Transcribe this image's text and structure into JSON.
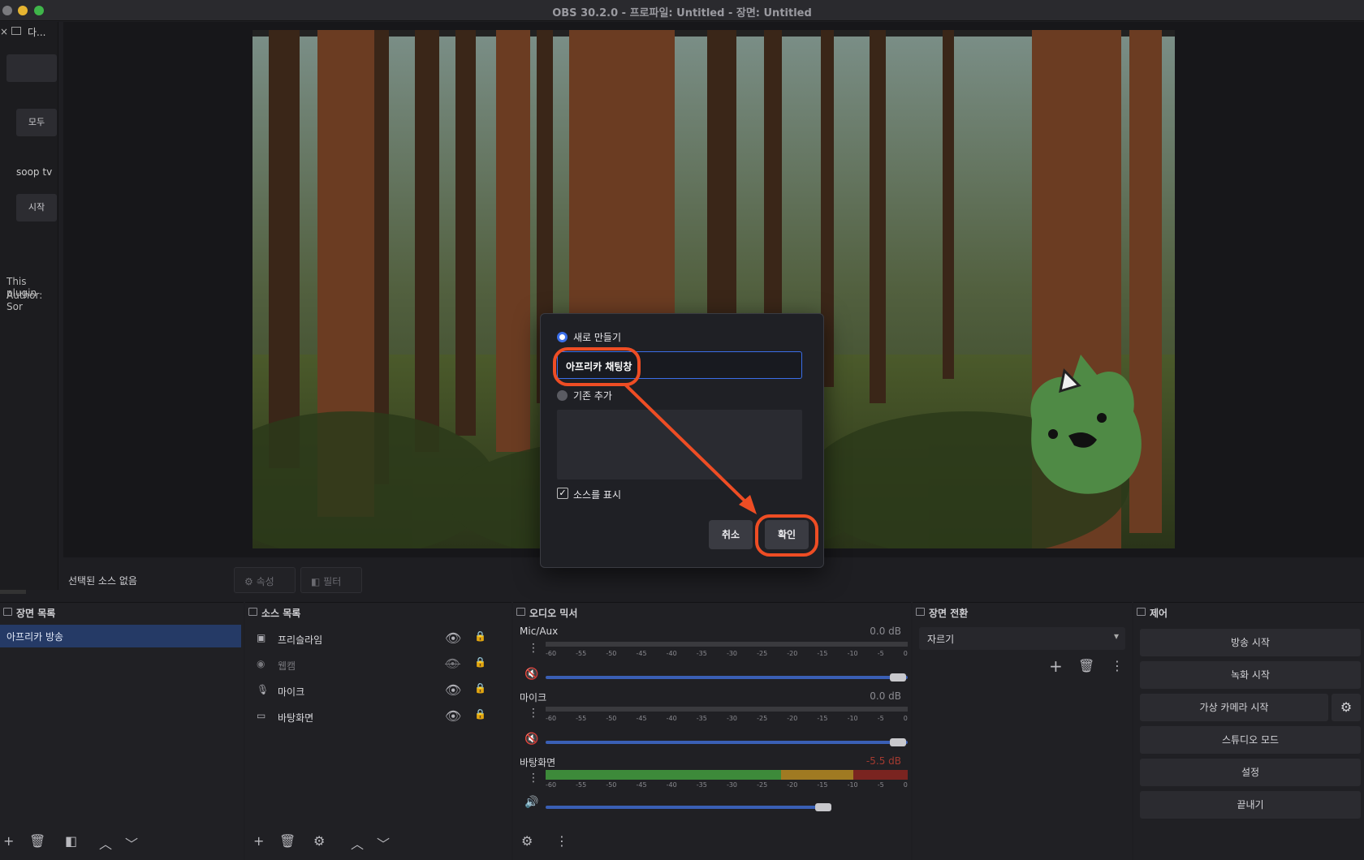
{
  "window": {
    "title": "OBS 30.2.0 - 프로파일: Untitled - 장면: Untitled"
  },
  "left_dock": {
    "tab_label": "다...",
    "all_button": "모두 ",
    "service_label": "soop tv",
    "start_button": "시작",
    "plugin_line1": "This plugin",
    "plugin_line2": "Author: Sor"
  },
  "status": {
    "no_source": "선택된 소스 없음",
    "properties": "속성",
    "filters": "필터"
  },
  "scenes": {
    "title": "장면 목록",
    "items": [
      "아프리카 방송"
    ]
  },
  "sources": {
    "title": "소스 목록",
    "items": [
      {
        "name": "프리슬라임",
        "icon": "image-icon",
        "visible": true
      },
      {
        "name": "웹캠",
        "icon": "camera-icon",
        "visible": false
      },
      {
        "name": "마이크",
        "icon": "mic-icon",
        "visible": true
      },
      {
        "name": "바탕화면",
        "icon": "monitor-icon",
        "visible": true
      }
    ]
  },
  "mixer": {
    "title": "오디오 믹서",
    "ticks": [
      "-60",
      "-55",
      "-50",
      "-45",
      "-40",
      "-35",
      "-30",
      "-25",
      "-20",
      "-15",
      "-10",
      "-5",
      "0"
    ],
    "channels": [
      {
        "name": "Mic/Aux",
        "db": "0.0 dB",
        "muted": true
      },
      {
        "name": "마이크",
        "db": "0.0 dB",
        "muted": true
      },
      {
        "name": "바탕화면",
        "db": "-5.5 dB",
        "muted": false
      }
    ]
  },
  "transitions": {
    "title": "장면 전환",
    "selected": "자르기"
  },
  "controls": {
    "title": "제어",
    "start_stream": "방송 시작",
    "start_record": "녹화 시작",
    "virtual_cam": "가상 카메라 시작",
    "studio_mode": "스튜디오 모드",
    "settings": "설정",
    "exit": "끝내기"
  },
  "dialog": {
    "create_new": "새로 만들기",
    "name_value": "아프리카 채팅창",
    "add_existing": "기존 추가",
    "show_source": "소스를 표시",
    "cancel": "취소",
    "ok": "확인"
  },
  "colors": {
    "accent": "#3a6ee8",
    "highlight": "#ee4d24",
    "scene_selected": "#253a66"
  }
}
